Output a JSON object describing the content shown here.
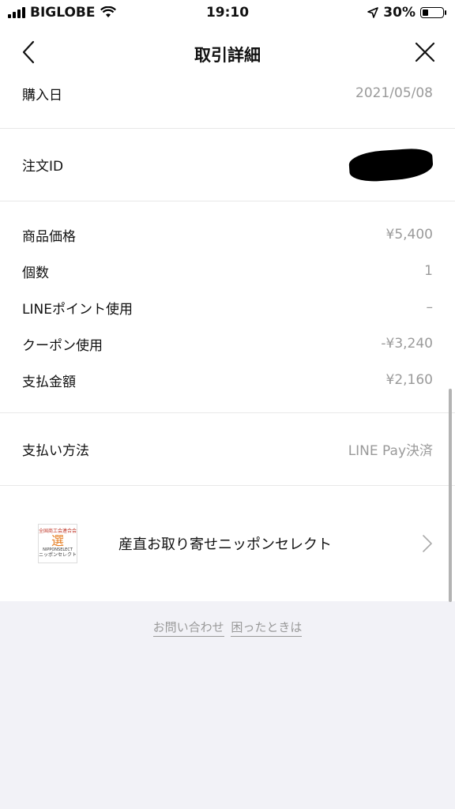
{
  "status_bar": {
    "carrier": "BIGLOBE",
    "time": "19:10",
    "battery": "30%",
    "battery_level": 0.3
  },
  "nav": {
    "title": "取引詳細"
  },
  "purchase": {
    "label": "購入日",
    "value": "2021/05/08"
  },
  "order": {
    "label": "注文ID"
  },
  "prices": [
    {
      "label": "商品価格",
      "value": "¥5,400"
    },
    {
      "label": "個数",
      "value": "1"
    },
    {
      "label": "LINEポイント使用",
      "value": "–"
    },
    {
      "label": "クーポン使用",
      "value": "-¥3,240"
    },
    {
      "label": "支払金額",
      "value": "¥2,160"
    }
  ],
  "payment": {
    "label": "支払い方法",
    "value": "LINE Pay決済"
  },
  "shop": {
    "name": "産直お取り寄せニッポンセレクト",
    "logo_tag": "全国商工会連合会",
    "logo_char": "選",
    "logo_en": "NIPPONSELECT",
    "logo_jp": "ニッポンセレクト"
  },
  "footer": {
    "contact": "お問い合わせ",
    "help": "困ったときは"
  }
}
